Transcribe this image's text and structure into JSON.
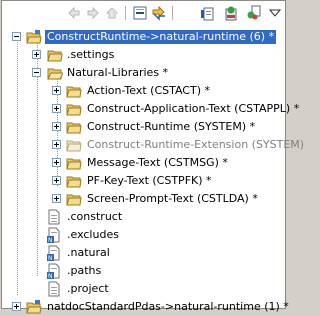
{
  "toolbar": {
    "buttons": [
      {
        "name": "back-arrow-icon",
        "enabled": false
      },
      {
        "name": "forward-arrow-icon",
        "enabled": false
      },
      {
        "name": "home-icon",
        "enabled": false
      },
      {
        "name": "collapse-all-icon",
        "enabled": true
      },
      {
        "name": "link-with-editor-icon",
        "enabled": true
      },
      {
        "name": "new-object-icon",
        "enabled": true
      },
      {
        "name": "build-icon",
        "enabled": true
      },
      {
        "name": "filter-icon",
        "enabled": true
      },
      {
        "name": "view-menu-icon",
        "enabled": true
      }
    ]
  },
  "tree": {
    "rows": [
      {
        "label": "ConstructRuntime->natural-runtime (6) *",
        "type": "project",
        "selected": true
      },
      {
        "label": ".settings",
        "type": "folder"
      },
      {
        "label": "Natural-Libraries  *",
        "type": "folder-open"
      },
      {
        "label": "Action-Text (CSTACT) *",
        "type": "library"
      },
      {
        "label": "Construct-Application-Text (CSTAPPL) *",
        "type": "library"
      },
      {
        "label": "Construct-Runtime (SYSTEM) *",
        "type": "library"
      },
      {
        "label": "Construct-Runtime-Extension (SYSTEM)",
        "type": "library",
        "dimmed": true
      },
      {
        "label": "Message-Text (CSTMSG) *",
        "type": "library"
      },
      {
        "label": "PF-Key-Text (CSTPFK) *",
        "type": "library"
      },
      {
        "label": "Screen-Prompt-Text (CSTLDA) *",
        "type": "library"
      },
      {
        "label": ".construct",
        "type": "file"
      },
      {
        "label": ".excludes",
        "type": "file-n"
      },
      {
        "label": ".natural",
        "type": "file-n"
      },
      {
        "label": ".paths",
        "type": "file-n"
      },
      {
        "label": ".project",
        "type": "file"
      },
      {
        "label": "natdocStandardPdas->natural-runtime (1) *",
        "type": "project"
      }
    ]
  },
  "colors": {
    "selection": "#316ac5",
    "folder": "#e8c766",
    "dimmed": "#808080"
  }
}
